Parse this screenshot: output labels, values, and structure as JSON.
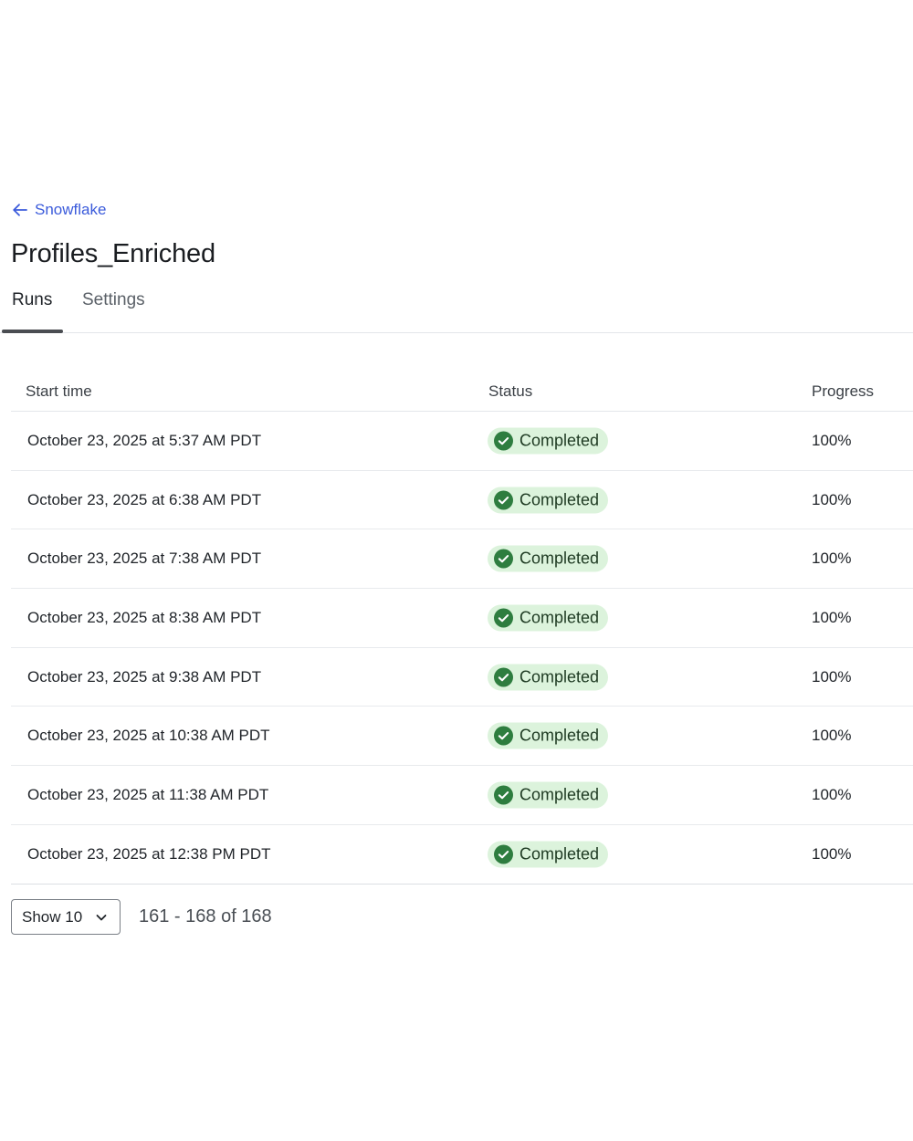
{
  "breadcrumb": {
    "back_label": "Snowflake"
  },
  "page": {
    "title": "Profiles_Enriched"
  },
  "tabs": [
    {
      "label": "Runs",
      "active": true
    },
    {
      "label": "Settings",
      "active": false
    }
  ],
  "table": {
    "columns": [
      "Start time",
      "Status",
      "Progress"
    ],
    "rows": [
      {
        "start_time": "October 23, 2025 at 5:37 AM PDT",
        "status": "Completed",
        "progress": "100%"
      },
      {
        "start_time": "October 23, 2025 at 6:38 AM PDT",
        "status": "Completed",
        "progress": "100%"
      },
      {
        "start_time": "October 23, 2025 at 7:38 AM PDT",
        "status": "Completed",
        "progress": "100%"
      },
      {
        "start_time": "October 23, 2025 at 8:38 AM PDT",
        "status": "Completed",
        "progress": "100%"
      },
      {
        "start_time": "October 23, 2025 at 9:38 AM PDT",
        "status": "Completed",
        "progress": "100%"
      },
      {
        "start_time": "October 23, 2025 at 10:38 AM PDT",
        "status": "Completed",
        "progress": "100%"
      },
      {
        "start_time": "October 23, 2025 at 11:38 AM PDT",
        "status": "Completed",
        "progress": "100%"
      },
      {
        "start_time": "October 23, 2025 at 12:38 PM PDT",
        "status": "Completed",
        "progress": "100%"
      }
    ]
  },
  "pagination": {
    "page_size_label": "Show 10",
    "range_label": "161 - 168 of 168"
  },
  "icons": {
    "back": "arrow-left-icon",
    "status": "check-circle-icon",
    "dropdown": "chevron-down-icon"
  },
  "colors": {
    "link": "#3b5bdb",
    "badge_bg": "#dcf3dc",
    "badge_icon": "#2e7d3f",
    "tab_indicator": "#4a4d52"
  }
}
